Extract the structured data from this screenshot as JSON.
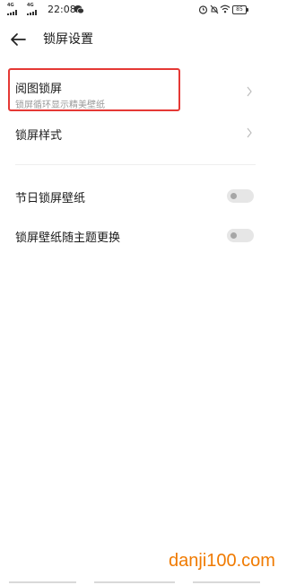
{
  "status_bar": {
    "signal1": "4G",
    "signal2": "4G",
    "time": "22:08",
    "battery": "85"
  },
  "header": {
    "title": "锁屏设置",
    "back_icon": "arrow-left-icon"
  },
  "items": [
    {
      "title": "阅图锁屏",
      "subtitle": "锁屏循环显示精美壁纸",
      "control": "chevron",
      "highlighted": true
    },
    {
      "title": "锁屏样式",
      "control": "chevron"
    },
    {
      "title": "节日锁屏壁纸",
      "control": "toggle",
      "enabled": false
    },
    {
      "title": "锁屏壁纸随主题更换",
      "control": "toggle",
      "enabled": false
    }
  ],
  "watermark": {
    "text": "danji100.com",
    "color": "#f07a00"
  },
  "colors": {
    "highlight": "#e53935",
    "subtitle": "#9a9a9a",
    "toggle_off": "#e6e6e6"
  }
}
